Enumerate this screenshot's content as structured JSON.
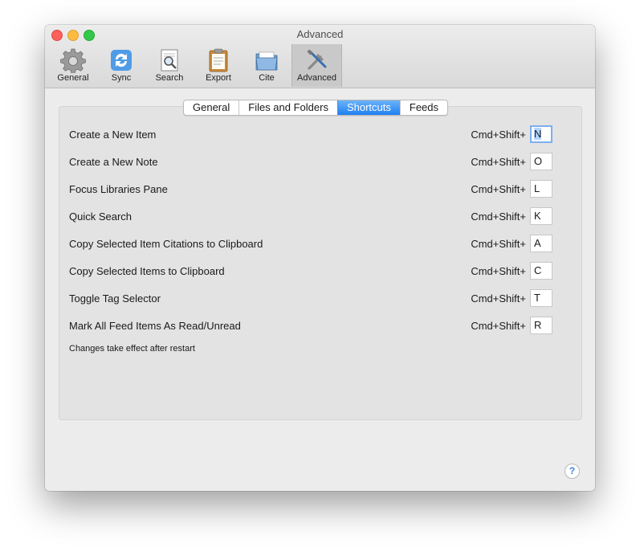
{
  "window": {
    "title": "Advanced"
  },
  "toolbar": {
    "items": [
      {
        "label": "General",
        "icon": "gear-icon"
      },
      {
        "label": "Sync",
        "icon": "sync-icon"
      },
      {
        "label": "Search",
        "icon": "search-document-icon"
      },
      {
        "label": "Export",
        "icon": "clipboard-icon"
      },
      {
        "label": "Cite",
        "icon": "folder-icon"
      },
      {
        "label": "Advanced",
        "icon": "tools-icon",
        "selected": true
      }
    ]
  },
  "tabs": [
    {
      "label": "General"
    },
    {
      "label": "Files and Folders"
    },
    {
      "label": "Shortcuts",
      "active": true
    },
    {
      "label": "Feeds"
    }
  ],
  "shortcuts": [
    {
      "label": "Create a New Item",
      "modifier": "Cmd+Shift+",
      "key": "N"
    },
    {
      "label": "Create a New Note",
      "modifier": "Cmd+Shift+",
      "key": "O"
    },
    {
      "label": "Focus Libraries Pane",
      "modifier": "Cmd+Shift+",
      "key": "L"
    },
    {
      "label": "Quick Search",
      "modifier": "Cmd+Shift+",
      "key": "K"
    },
    {
      "label": "Copy Selected Item Citations to Clipboard",
      "modifier": "Cmd+Shift+",
      "key": "A"
    },
    {
      "label": "Copy Selected Items to Clipboard",
      "modifier": "Cmd+Shift+",
      "key": "C"
    },
    {
      "label": "Toggle Tag Selector",
      "modifier": "Cmd+Shift+",
      "key": "T"
    },
    {
      "label": "Mark All Feed Items As Read/Unread",
      "modifier": "Cmd+Shift+",
      "key": "R"
    }
  ],
  "note": "Changes take effect after restart",
  "help": {
    "label": "?"
  },
  "colors": {
    "accent": "#1e80f0",
    "close": "#fc605b",
    "minimize": "#fdbc40",
    "zoom": "#34c84a"
  }
}
